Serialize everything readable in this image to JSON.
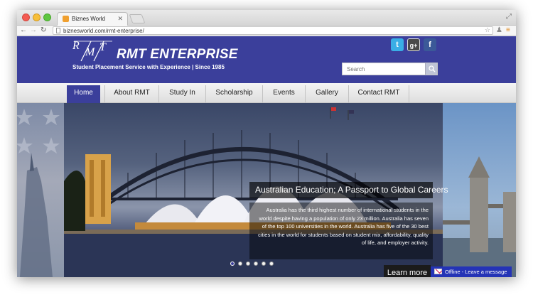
{
  "browser": {
    "tab_title": "Biznes World",
    "url": "biznesworld.com/rmt-enterprise/"
  },
  "header": {
    "logo_letters": [
      "R",
      "M",
      "T"
    ],
    "title": "RMT ENTERPRISE",
    "tagline": "Student Placement Service with Experience  |  Since 1985",
    "search_placeholder": "Search",
    "social": [
      "twitter-icon",
      "google-plus-icon",
      "facebook-icon"
    ],
    "brand_color": "#3b3f9b"
  },
  "nav": {
    "items": [
      {
        "label": "Home",
        "active": true
      },
      {
        "label": "About RMT",
        "active": false
      },
      {
        "label": "Study In",
        "active": false
      },
      {
        "label": "Scholarship",
        "active": false
      },
      {
        "label": "Events",
        "active": false
      },
      {
        "label": "Gallery",
        "active": false
      },
      {
        "label": "Contact RMT",
        "active": false
      }
    ]
  },
  "hero": {
    "caption_title": "Australian Education; A Passport to Global Careers",
    "caption_body": "Australia has the third highest number of international students in the world despite having a population of only 23 million. Australia has seven of the top 100 universities in the world.  Australia has five of the 30 best cities in the world for students based on student mix, affordability, quality of life, and employer activity.",
    "slide_count": 6,
    "active_slide": 1,
    "learn_more": "Learn more"
  },
  "chat": {
    "status": "Offline",
    "message": "Offline - Leave a message"
  }
}
